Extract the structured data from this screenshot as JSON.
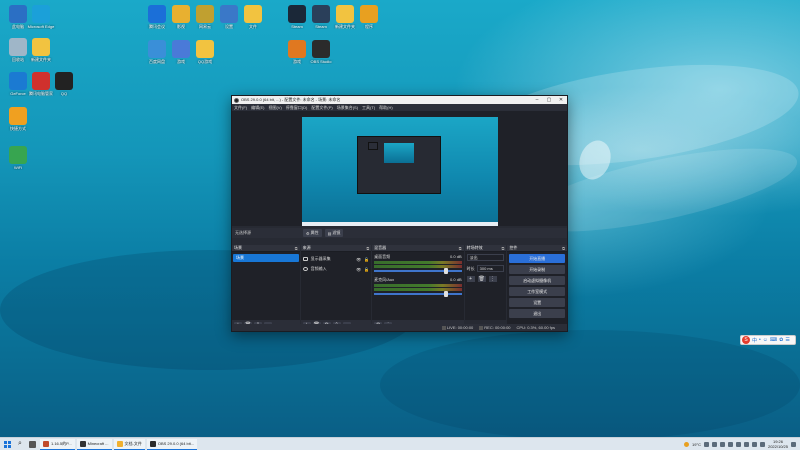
{
  "desktop_icons": [
    {
      "id": "d1",
      "label": "此电脑",
      "icon": "computer-icon",
      "color": "#2b6fc4"
    },
    {
      "id": "d2",
      "label": "Microsoft Edge",
      "icon": "edge-icon",
      "color": "#1ba0d9"
    },
    {
      "id": "d3",
      "label": "回收站",
      "icon": "recycle-bin-icon",
      "color": "#9fb6c8"
    },
    {
      "id": "d4",
      "label": "新建文件夹",
      "icon": "folder-icon",
      "color": "#f2c340"
    },
    {
      "id": "d5",
      "label": "GeForce",
      "icon": "geforce-icon",
      "color": "#1b7ad2"
    },
    {
      "id": "d6",
      "label": "腾讯电脑管家",
      "icon": "tencent-manager-icon",
      "color": "#d0312d"
    },
    {
      "id": "d7",
      "label": "QQ",
      "icon": "qq-icon",
      "color": "#222222"
    },
    {
      "id": "d8",
      "label": "快捷方式",
      "icon": "shield-icon",
      "color": "#f0a020"
    },
    {
      "id": "d9",
      "label": "WiFi",
      "icon": "wifi-icon",
      "color": "#37a550"
    },
    {
      "id": "d10",
      "label": "腾讯会议",
      "icon": "meeting-icon",
      "color": "#1b6fd8"
    },
    {
      "id": "d11",
      "label": "影视",
      "icon": "video-icon",
      "color": "#e8b030"
    },
    {
      "id": "d12",
      "label": "网易云",
      "icon": "app-icon",
      "color": "#c0a030"
    },
    {
      "id": "d13",
      "label": "设置",
      "icon": "tools-icon",
      "color": "#3a78c8"
    },
    {
      "id": "d14",
      "label": "文件",
      "icon": "file-icon",
      "color": "#f2c340"
    },
    {
      "id": "d15",
      "label": "百度网盘",
      "icon": "baidu-icon",
      "color": "#3a8fd8"
    },
    {
      "id": "d16",
      "label": "游戏",
      "icon": "game-icon",
      "color": "#4a7ad8"
    },
    {
      "id": "d17",
      "label": "QQ游戏",
      "icon": "qq-game-icon",
      "color": "#f2c340"
    },
    {
      "id": "d18",
      "label": "Steam",
      "icon": "steam-icon",
      "color": "#1b2838"
    },
    {
      "id": "d19",
      "label": "Steam",
      "icon": "steam-icon",
      "color": "#2a3f5a"
    },
    {
      "id": "d20",
      "label": "新建文件夹",
      "icon": "folder-icon",
      "color": "#f2c340"
    },
    {
      "id": "d21",
      "label": "程序",
      "icon": "program-icon",
      "color": "#e8a020"
    },
    {
      "id": "d22",
      "label": "游戏",
      "icon": "game-icon",
      "color": "#e07820"
    },
    {
      "id": "d23",
      "label": "OBS Studio",
      "icon": "obs-icon",
      "color": "#2b2b2b"
    }
  ],
  "obs": {
    "title": "OBS 29.0.0 (64 bit, ...) - 配置文件: 未命名 - 场景: 未命名",
    "menu": [
      "文件(F)",
      "编辑(E)",
      "视图(V)",
      "停靠窗口(D)",
      "配置文件(P)",
      "场景集合(S)",
      "工具(T)",
      "帮助(H)"
    ],
    "ctx_label": "无选择源",
    "ctx_buttons": [
      "属性",
      "滤镜"
    ],
    "docks": {
      "scenes": {
        "title": "场景",
        "items": [
          "场景"
        ]
      },
      "sources": {
        "title": "来源",
        "items": [
          "显示器采集",
          "音频输入"
        ]
      },
      "mixer": {
        "title": "混音器",
        "channels": [
          {
            "name": "桌面音频",
            "db": "0.0 dB"
          },
          {
            "name": "麦克风/Aux",
            "db": "0.0 dB"
          }
        ]
      },
      "transitions": {
        "title": "转场特效",
        "type": "淡出",
        "duration_label": "时长",
        "duration": "300 ms"
      },
      "controls": {
        "title": "控件",
        "buttons": [
          "开始直播",
          "开始录制",
          "启动虚拟摄像机",
          "工作室模式",
          "设置",
          "退出"
        ]
      }
    },
    "status": {
      "live": "LIVE: 00:00:00",
      "rec": "REC: 00:00:00",
      "cpu": "CPU: 0.3%, 60.00 fps"
    }
  },
  "taskbar": {
    "tasks": [
      {
        "label": "1.16.5的P...",
        "color": "#c04a2a"
      },
      {
        "label": "Minecraft ...",
        "color": "#333333"
      },
      {
        "label": "文档-文件",
        "color": "#f0b030"
      },
      {
        "label": "OBS 29.0.0 (64 bit...",
        "color": "#2b2b2b"
      }
    ],
    "weather": "19°C",
    "time": "19:26",
    "date": "2022/10/25"
  },
  "ime": {
    "label": "中"
  }
}
